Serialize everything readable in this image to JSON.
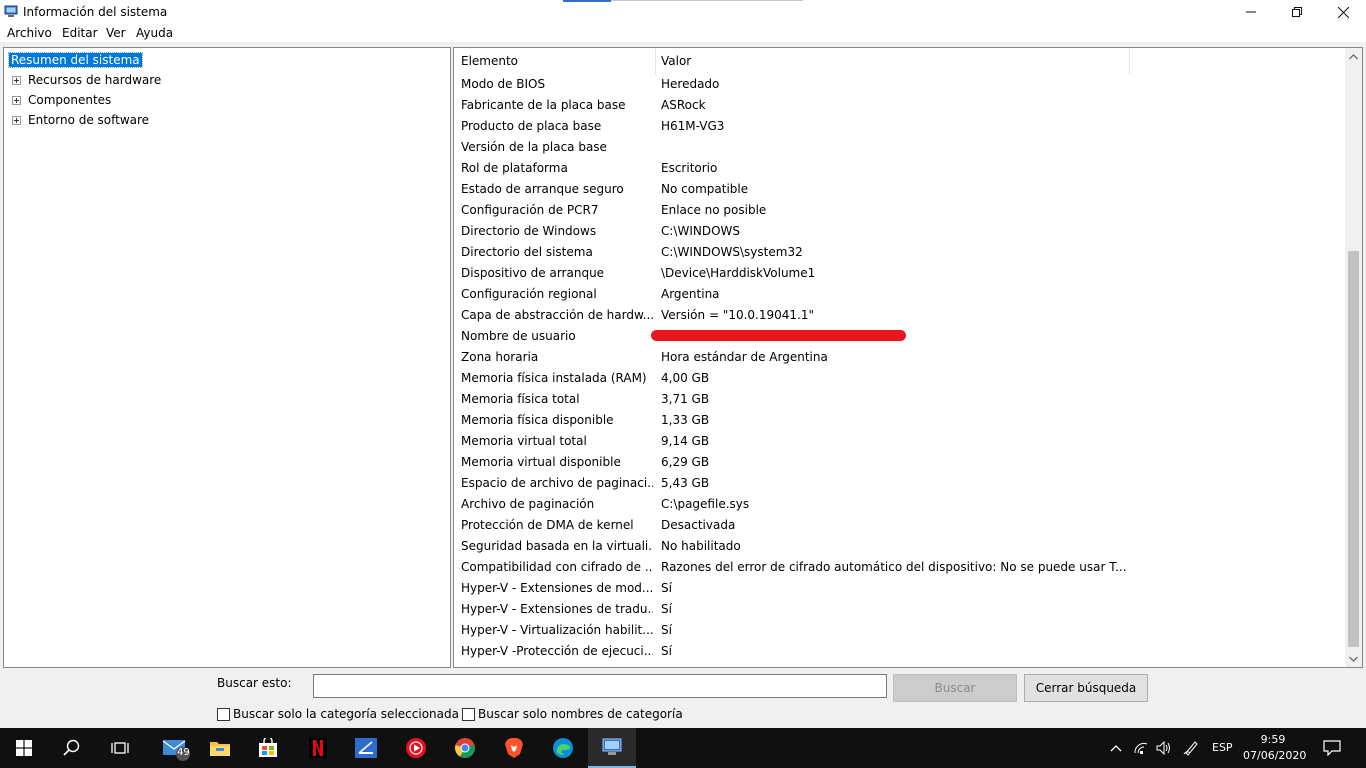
{
  "window": {
    "title": "Información del sistema"
  },
  "menu": [
    "Archivo",
    "Editar",
    "Ver",
    "Ayuda"
  ],
  "tree": {
    "root": "Resumen del sistema",
    "children": [
      "Recursos de hardware",
      "Componentes",
      "Entorno de software"
    ]
  },
  "columns": {
    "item": "Elemento",
    "value": "Valor"
  },
  "rows": [
    {
      "k": "Modo de BIOS",
      "v": "Heredado"
    },
    {
      "k": "Fabricante de la placa base",
      "v": "ASRock"
    },
    {
      "k": "Producto de placa base",
      "v": "H61M-VG3"
    },
    {
      "k": "Versión de la placa base",
      "v": ""
    },
    {
      "k": "Rol de plataforma",
      "v": "Escritorio"
    },
    {
      "k": "Estado de arranque seguro",
      "v": "No compatible"
    },
    {
      "k": "Configuración de PCR7",
      "v": "Enlace no posible"
    },
    {
      "k": "Directorio de Windows",
      "v": "C:\\WINDOWS"
    },
    {
      "k": "Directorio del sistema",
      "v": "C:\\WINDOWS\\system32"
    },
    {
      "k": "Dispositivo de arranque",
      "v": "\\Device\\HarddiskVolume1"
    },
    {
      "k": "Configuración regional",
      "v": "Argentina"
    },
    {
      "k": "Capa de abstracción de hardw...",
      "v": "Versión = \"10.0.19041.1\""
    },
    {
      "k": "Nombre de usuario",
      "v": ""
    },
    {
      "k": "Zona horaria",
      "v": "Hora estándar de Argentina"
    },
    {
      "k": "Memoria física instalada (RAM)",
      "v": "4,00 GB"
    },
    {
      "k": "Memoria física total",
      "v": "3,71 GB"
    },
    {
      "k": "Memoria física disponible",
      "v": "1,33 GB"
    },
    {
      "k": "Memoria virtual total",
      "v": "9,14 GB"
    },
    {
      "k": "Memoria virtual disponible",
      "v": "6,29 GB"
    },
    {
      "k": "Espacio de archivo de paginaci...",
      "v": "5,43 GB"
    },
    {
      "k": "Archivo de paginación",
      "v": "C:\\pagefile.sys"
    },
    {
      "k": "Protección de DMA de kernel",
      "v": "Desactivada"
    },
    {
      "k": "Seguridad basada en la virtuali...",
      "v": "No habilitado"
    },
    {
      "k": "Compatibilidad con cifrado de ...",
      "v": "Razones del error de cifrado automático del dispositivo: No se puede usar T..."
    },
    {
      "k": "Hyper-V - Extensiones de mod...",
      "v": "Sí"
    },
    {
      "k": "Hyper-V - Extensiones de tradu...",
      "v": "Sí"
    },
    {
      "k": "Hyper-V - Virtualización habilit...",
      "v": "Sí"
    },
    {
      "k": "Hyper-V -Protección de ejecuci...",
      "v": "Sí"
    }
  ],
  "search": {
    "label": "Buscar esto:",
    "value": "",
    "search_button": "Buscar",
    "close_button": "Cerrar búsqueda",
    "only_selected_category": "Buscar solo la categoría seleccionada",
    "only_category_names": "Buscar solo nombres de categoría"
  },
  "taskbar": {
    "mail_badge": "49",
    "language": "ESP",
    "time": "9:59",
    "date": "07/06/2020"
  },
  "colors": {
    "selection": "#0078d7",
    "redaction": "#e8171f",
    "taskbar": "#101010"
  }
}
